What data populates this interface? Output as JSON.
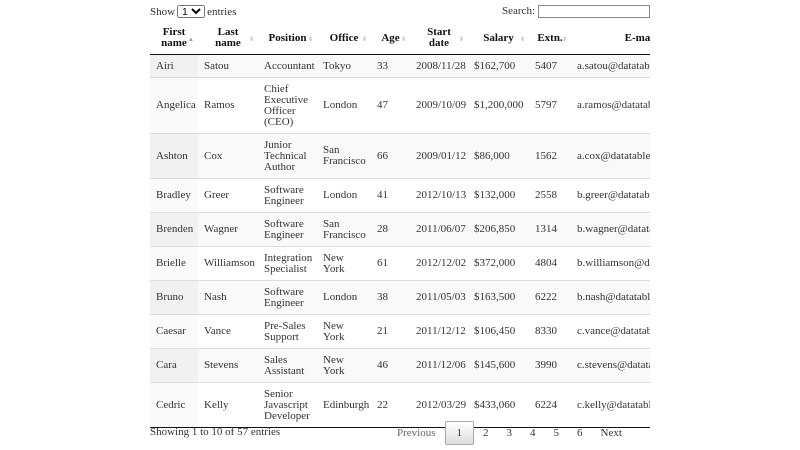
{
  "length": {
    "show": "Show",
    "value": "10",
    "entries": "entries"
  },
  "search": {
    "label": "Search:",
    "value": ""
  },
  "columns": [
    "First name",
    "Last name",
    "Position",
    "Office",
    "Age",
    "Start date",
    "Salary",
    "Extn.",
    "E-mail"
  ],
  "rows": [
    [
      "Airi",
      "Satou",
      "Accountant",
      "Tokyo",
      "33",
      "2008/11/28",
      "$162,700",
      "5407",
      "a.satou@datatables.net"
    ],
    [
      "Angelica",
      "Ramos",
      "Chief Executive Officer (CEO)",
      "London",
      "47",
      "2009/10/09",
      "$1,200,000",
      "5797",
      "a.ramos@datatables.net"
    ],
    [
      "Ashton",
      "Cox",
      "Junior Technical Author",
      "San Francisco",
      "66",
      "2009/01/12",
      "$86,000",
      "1562",
      "a.cox@datatables.net"
    ],
    [
      "Bradley",
      "Greer",
      "Software Engineer",
      "London",
      "41",
      "2012/10/13",
      "$132,000",
      "2558",
      "b.greer@datatables.net"
    ],
    [
      "Brenden",
      "Wagner",
      "Software Engineer",
      "San Francisco",
      "28",
      "2011/06/07",
      "$206,850",
      "1314",
      "b.wagner@datatables.net"
    ],
    [
      "Brielle",
      "Williamson",
      "Integration Specialist",
      "New York",
      "61",
      "2012/12/02",
      "$372,000",
      "4804",
      "b.williamson@datatables.net"
    ],
    [
      "Bruno",
      "Nash",
      "Software Engineer",
      "London",
      "38",
      "2011/05/03",
      "$163,500",
      "6222",
      "b.nash@datatables.net"
    ],
    [
      "Caesar",
      "Vance",
      "Pre-Sales Support",
      "New York",
      "21",
      "2011/12/12",
      "$106,450",
      "8330",
      "c.vance@datatables.net"
    ],
    [
      "Cara",
      "Stevens",
      "Sales Assistant",
      "New York",
      "46",
      "2011/12/06",
      "$145,600",
      "3990",
      "c.stevens@datatables.net"
    ],
    [
      "Cedric",
      "Kelly",
      "Senior Javascript Developer",
      "Edinburgh",
      "22",
      "2012/03/29",
      "$433,060",
      "6224",
      "c.kelly@datatables.net"
    ]
  ],
  "info": "Showing 1 to 10 of 57 entries",
  "pagination": {
    "previous": "Previous",
    "pages": [
      "1",
      "2",
      "3",
      "4",
      "5",
      "6"
    ],
    "current": "1",
    "next": "Next"
  }
}
